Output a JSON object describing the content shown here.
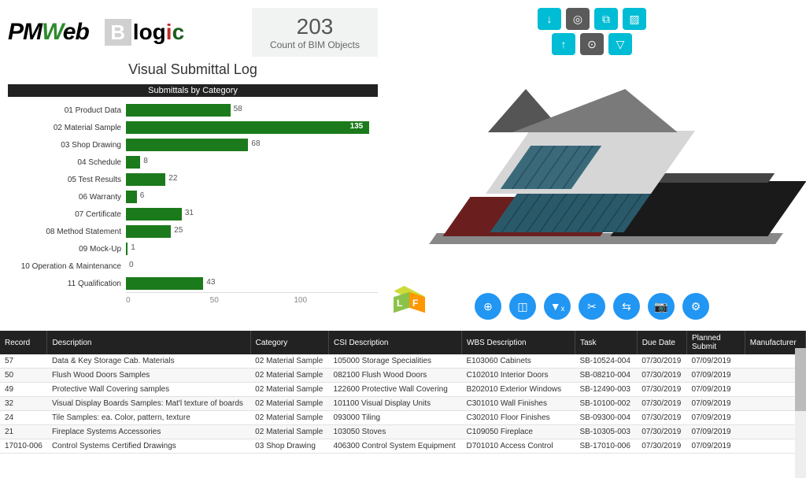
{
  "header": {
    "logo1_pm": "PM",
    "logo1_w": "W",
    "logo1_eb": "eb",
    "logo2_b": "B",
    "logo2_log": "log",
    "logo2_i": "i",
    "logo2_c": "c",
    "count_value": "203",
    "count_label": "Count of BIM Objects",
    "title": "Visual Submittal Log"
  },
  "chart_data": {
    "type": "bar",
    "title": "Submittals by Category",
    "orientation": "horizontal",
    "categories": [
      "01 Product Data",
      "02 Material Sample",
      "03 Shop Drawing",
      "04 Schedule",
      "05 Test Results",
      "06 Warranty",
      "07 Certificate",
      "08 Method Statement",
      "09 Mock-Up",
      "10 Operation & Maintenance",
      "11 Qualification"
    ],
    "values": [
      58,
      135,
      68,
      8,
      22,
      6,
      31,
      25,
      1,
      0,
      43
    ],
    "xlabel": "",
    "ylabel": "",
    "xlim": [
      0,
      140
    ],
    "ticks": [
      0,
      50,
      100
    ],
    "bar_color": "#1b7a1b",
    "highlight_index": 1
  },
  "viewer": {
    "top_icons": [
      "arrow-down",
      "target",
      "duplicate",
      "hatch",
      "arrow-up",
      "target-alt",
      "filter"
    ],
    "bottom_icons": [
      "reticle",
      "select-box",
      "filter-clear",
      "cut",
      "share",
      "camera",
      "settings"
    ],
    "cube_left": "L",
    "cube_front": "F"
  },
  "table": {
    "columns": [
      "Record",
      "Description",
      "Category",
      "CSI Description",
      "WBS Description",
      "Task",
      "Due Date",
      "Planned Submit",
      "Manufacturer"
    ],
    "rows": [
      {
        "rec": "57",
        "desc": "Data & Key Storage Cab. Materials",
        "cat": "02 Material Sample",
        "csi": "105000 Storage Specialities",
        "wbs": "E103060 Cabinets",
        "task": "SB-10524-004",
        "due": "07/30/2019",
        "plan": "07/09/2019",
        "mfr": ""
      },
      {
        "rec": "50",
        "desc": "Flush Wood Doors Samples",
        "cat": "02 Material Sample",
        "csi": "082100 Flush Wood Doors",
        "wbs": "C102010 Interior Doors",
        "task": "SB-08210-004",
        "due": "07/30/2019",
        "plan": "07/09/2019",
        "mfr": ""
      },
      {
        "rec": "49",
        "desc": "Protective Wall Covering samples",
        "cat": "02 Material Sample",
        "csi": "122600 Protective Wall Covering",
        "wbs": "B202010 Exterior Windows",
        "task": "SB-12490-003",
        "due": "07/30/2019",
        "plan": "07/09/2019",
        "mfr": ""
      },
      {
        "rec": "32",
        "desc": "Visual Display Boards Samples: Mat'l texture of boards",
        "cat": "02 Material Sample",
        "csi": "101100 Visual Display Units",
        "wbs": "C301010 Wall Finishes",
        "task": "SB-10100-002",
        "due": "07/30/2019",
        "plan": "07/09/2019",
        "mfr": ""
      },
      {
        "rec": "24",
        "desc": "Tile Samples: ea. Color, pattern, texture",
        "cat": "02 Material Sample",
        "csi": "093000 Tiling",
        "wbs": "C302010 Floor Finishes",
        "task": "SB-09300-004",
        "due": "07/30/2019",
        "plan": "07/09/2019",
        "mfr": ""
      },
      {
        "rec": "21",
        "desc": "Fireplace Systems Accessories",
        "cat": "02 Material Sample",
        "csi": "103050 Stoves",
        "wbs": "C109050 Fireplace",
        "task": "SB-10305-003",
        "due": "07/30/2019",
        "plan": "07/09/2019",
        "mfr": ""
      },
      {
        "rec": "17010-006",
        "desc": "Control Systems Certified Drawings",
        "cat": "03 Shop Drawing",
        "csi": "406300 Control System Equipment",
        "wbs": "D701010 Access Control",
        "task": "SB-17010-006",
        "due": "07/30/2019",
        "plan": "07/09/2019",
        "mfr": ""
      }
    ]
  }
}
